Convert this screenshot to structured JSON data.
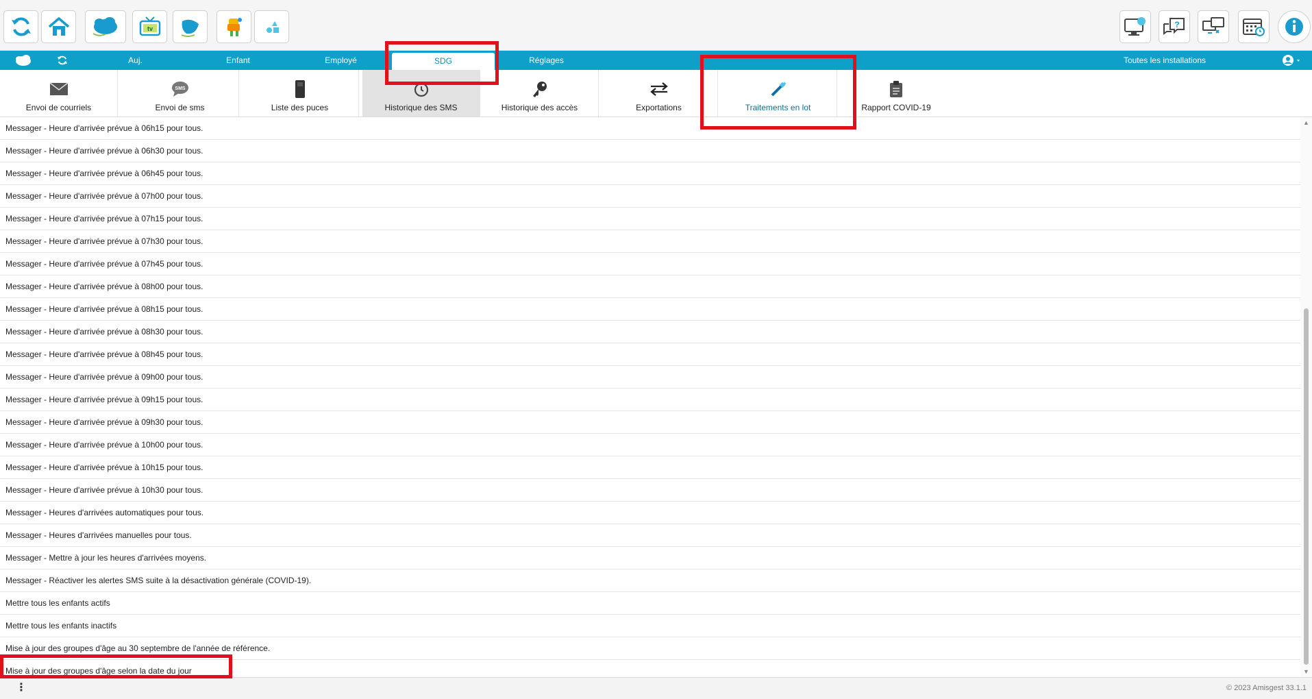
{
  "toolbar": {
    "left_icons": [
      "refresh-icon",
      "home-icon",
      "cloud-logo-icon",
      "tv-icon",
      "cloud-bird-icon",
      "kids-icon",
      "shapes-icon"
    ],
    "right_icons": [
      "monitor-settings-icon",
      "help-chat-icon",
      "remote-desktop-icon",
      "calendar-icon",
      "info-icon"
    ]
  },
  "nav": {
    "items": [
      {
        "label": "Auj."
      },
      {
        "label": "Enfant"
      },
      {
        "label": "Employé"
      },
      {
        "label": "SDG"
      },
      {
        "label": "Réglages"
      }
    ],
    "installations": "Toutes les installations"
  },
  "subnav": {
    "items": [
      {
        "label": "Envoi de courriels",
        "icon": "envelope-icon"
      },
      {
        "label": "Envoi de sms",
        "icon": "sms-icon"
      },
      {
        "label": "Liste des puces",
        "icon": "chip-icon"
      },
      {
        "label": "Historique des SMS",
        "icon": "history-icon"
      },
      {
        "label": "Historique des accès",
        "icon": "key-icon"
      },
      {
        "label": "Exportations",
        "icon": "transfer-icon"
      },
      {
        "label": "Traitements en lot",
        "icon": "magic-wand-icon"
      },
      {
        "label": "Rapport COVID-19",
        "icon": "clipboard-icon"
      }
    ]
  },
  "list": {
    "rows": [
      "Messager - Heure d'arrivée prévue à 06h15 pour tous.",
      "Messager - Heure d'arrivée prévue à 06h30 pour tous.",
      "Messager - Heure d'arrivée prévue à 06h45 pour tous.",
      "Messager - Heure d'arrivée prévue à 07h00 pour tous.",
      "Messager - Heure d'arrivée prévue à 07h15 pour tous.",
      "Messager - Heure d'arrivée prévue à 07h30 pour tous.",
      "Messager - Heure d'arrivée prévue à 07h45 pour tous.",
      "Messager - Heure d'arrivée prévue à 08h00 pour tous.",
      "Messager - Heure d'arrivée prévue à 08h15 pour tous.",
      "Messager - Heure d'arrivée prévue à 08h30 pour tous.",
      "Messager - Heure d'arrivée prévue à 08h45 pour tous.",
      "Messager - Heure d'arrivée prévue à 09h00 pour tous.",
      "Messager - Heure d'arrivée prévue à 09h15 pour tous.",
      "Messager - Heure d'arrivée prévue à 09h30 pour tous.",
      "Messager - Heure d'arrivée prévue à 10h00 pour tous.",
      "Messager - Heure d'arrivée prévue à 10h15 pour tous.",
      "Messager - Heure d'arrivée prévue à 10h30 pour tous.",
      "Messager - Heures d'arrivées automatiques pour tous.",
      "Messager - Heures d'arrivées manuelles pour tous.",
      "Messager - Mettre à jour les heures d'arrivées moyens.",
      "Messager - Réactiver les alertes SMS suite à la désactivation générale (COVID-19).",
      "Mettre tous les enfants actifs",
      "Mettre tous les enfants inactifs",
      "Mise à jour des groupes d'âge au 30 septembre de l'année de référence.",
      "Mise à jour des groupes d'âge selon la date du jour"
    ]
  },
  "footer": {
    "menu": "⋮",
    "copyright": "© 2023 Amisgest 33.1.1"
  },
  "colors": {
    "nav_blue": "#0ea0c9",
    "annotation_red": "#e0101c"
  }
}
